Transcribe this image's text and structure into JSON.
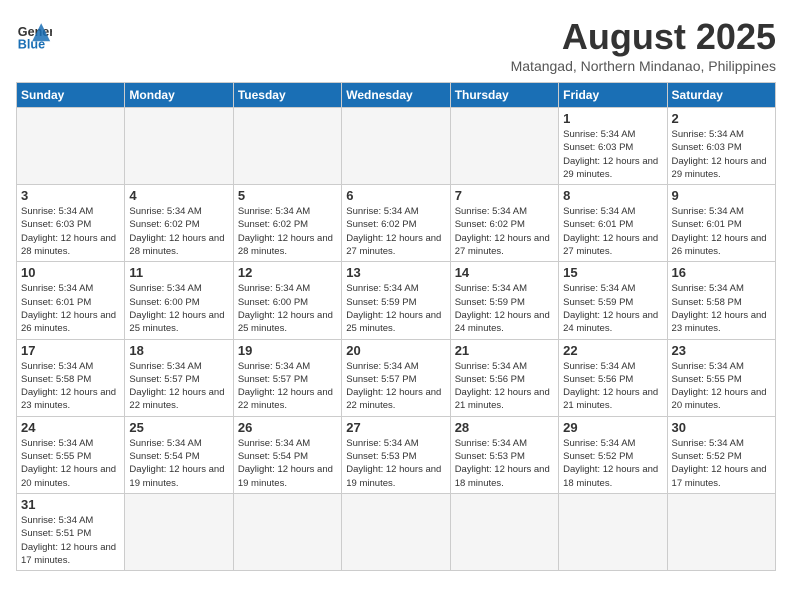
{
  "header": {
    "logo_general": "General",
    "logo_blue": "Blue",
    "title": "August 2025",
    "subtitle": "Matangad, Northern Mindanao, Philippines"
  },
  "weekdays": [
    "Sunday",
    "Monday",
    "Tuesday",
    "Wednesday",
    "Thursday",
    "Friday",
    "Saturday"
  ],
  "weeks": [
    [
      {
        "day": "",
        "info": ""
      },
      {
        "day": "",
        "info": ""
      },
      {
        "day": "",
        "info": ""
      },
      {
        "day": "",
        "info": ""
      },
      {
        "day": "",
        "info": ""
      },
      {
        "day": "1",
        "info": "Sunrise: 5:34 AM\nSunset: 6:03 PM\nDaylight: 12 hours and 29 minutes."
      },
      {
        "day": "2",
        "info": "Sunrise: 5:34 AM\nSunset: 6:03 PM\nDaylight: 12 hours and 29 minutes."
      }
    ],
    [
      {
        "day": "3",
        "info": "Sunrise: 5:34 AM\nSunset: 6:03 PM\nDaylight: 12 hours and 28 minutes."
      },
      {
        "day": "4",
        "info": "Sunrise: 5:34 AM\nSunset: 6:02 PM\nDaylight: 12 hours and 28 minutes."
      },
      {
        "day": "5",
        "info": "Sunrise: 5:34 AM\nSunset: 6:02 PM\nDaylight: 12 hours and 28 minutes."
      },
      {
        "day": "6",
        "info": "Sunrise: 5:34 AM\nSunset: 6:02 PM\nDaylight: 12 hours and 27 minutes."
      },
      {
        "day": "7",
        "info": "Sunrise: 5:34 AM\nSunset: 6:02 PM\nDaylight: 12 hours and 27 minutes."
      },
      {
        "day": "8",
        "info": "Sunrise: 5:34 AM\nSunset: 6:01 PM\nDaylight: 12 hours and 27 minutes."
      },
      {
        "day": "9",
        "info": "Sunrise: 5:34 AM\nSunset: 6:01 PM\nDaylight: 12 hours and 26 minutes."
      }
    ],
    [
      {
        "day": "10",
        "info": "Sunrise: 5:34 AM\nSunset: 6:01 PM\nDaylight: 12 hours and 26 minutes."
      },
      {
        "day": "11",
        "info": "Sunrise: 5:34 AM\nSunset: 6:00 PM\nDaylight: 12 hours and 25 minutes."
      },
      {
        "day": "12",
        "info": "Sunrise: 5:34 AM\nSunset: 6:00 PM\nDaylight: 12 hours and 25 minutes."
      },
      {
        "day": "13",
        "info": "Sunrise: 5:34 AM\nSunset: 5:59 PM\nDaylight: 12 hours and 25 minutes."
      },
      {
        "day": "14",
        "info": "Sunrise: 5:34 AM\nSunset: 5:59 PM\nDaylight: 12 hours and 24 minutes."
      },
      {
        "day": "15",
        "info": "Sunrise: 5:34 AM\nSunset: 5:59 PM\nDaylight: 12 hours and 24 minutes."
      },
      {
        "day": "16",
        "info": "Sunrise: 5:34 AM\nSunset: 5:58 PM\nDaylight: 12 hours and 23 minutes."
      }
    ],
    [
      {
        "day": "17",
        "info": "Sunrise: 5:34 AM\nSunset: 5:58 PM\nDaylight: 12 hours and 23 minutes."
      },
      {
        "day": "18",
        "info": "Sunrise: 5:34 AM\nSunset: 5:57 PM\nDaylight: 12 hours and 22 minutes."
      },
      {
        "day": "19",
        "info": "Sunrise: 5:34 AM\nSunset: 5:57 PM\nDaylight: 12 hours and 22 minutes."
      },
      {
        "day": "20",
        "info": "Sunrise: 5:34 AM\nSunset: 5:57 PM\nDaylight: 12 hours and 22 minutes."
      },
      {
        "day": "21",
        "info": "Sunrise: 5:34 AM\nSunset: 5:56 PM\nDaylight: 12 hours and 21 minutes."
      },
      {
        "day": "22",
        "info": "Sunrise: 5:34 AM\nSunset: 5:56 PM\nDaylight: 12 hours and 21 minutes."
      },
      {
        "day": "23",
        "info": "Sunrise: 5:34 AM\nSunset: 5:55 PM\nDaylight: 12 hours and 20 minutes."
      }
    ],
    [
      {
        "day": "24",
        "info": "Sunrise: 5:34 AM\nSunset: 5:55 PM\nDaylight: 12 hours and 20 minutes."
      },
      {
        "day": "25",
        "info": "Sunrise: 5:34 AM\nSunset: 5:54 PM\nDaylight: 12 hours and 19 minutes."
      },
      {
        "day": "26",
        "info": "Sunrise: 5:34 AM\nSunset: 5:54 PM\nDaylight: 12 hours and 19 minutes."
      },
      {
        "day": "27",
        "info": "Sunrise: 5:34 AM\nSunset: 5:53 PM\nDaylight: 12 hours and 19 minutes."
      },
      {
        "day": "28",
        "info": "Sunrise: 5:34 AM\nSunset: 5:53 PM\nDaylight: 12 hours and 18 minutes."
      },
      {
        "day": "29",
        "info": "Sunrise: 5:34 AM\nSunset: 5:52 PM\nDaylight: 12 hours and 18 minutes."
      },
      {
        "day": "30",
        "info": "Sunrise: 5:34 AM\nSunset: 5:52 PM\nDaylight: 12 hours and 17 minutes."
      }
    ],
    [
      {
        "day": "31",
        "info": "Sunrise: 5:34 AM\nSunset: 5:51 PM\nDaylight: 12 hours and 17 minutes."
      },
      {
        "day": "",
        "info": ""
      },
      {
        "day": "",
        "info": ""
      },
      {
        "day": "",
        "info": ""
      },
      {
        "day": "",
        "info": ""
      },
      {
        "day": "",
        "info": ""
      },
      {
        "day": "",
        "info": ""
      }
    ]
  ]
}
